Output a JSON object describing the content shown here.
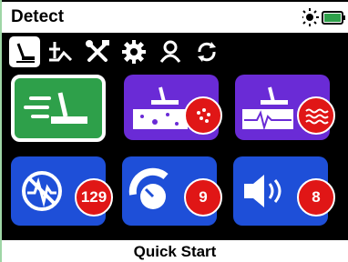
{
  "header": {
    "title": "Detect"
  },
  "status": {
    "icons": [
      "brightness-icon",
      "battery-icon"
    ],
    "battery_color": "#2ea04a"
  },
  "tabs": [
    {
      "icon": "detect-icon",
      "selected": true
    },
    {
      "icon": "ground-balance-icon"
    },
    {
      "icon": "tools-icon"
    },
    {
      "icon": "settings-icon"
    },
    {
      "icon": "user-icon"
    },
    {
      "icon": "sync-icon"
    }
  ],
  "tiles": [
    {
      "name": "quick-start",
      "icon": "coil-sweep-icon"
    },
    {
      "name": "ground-type",
      "icon": "ground-mineralization-icon"
    },
    {
      "name": "soil-noise",
      "icon": "noise-wave-icon"
    },
    {
      "name": "noise-cancel",
      "value": "129",
      "icon": "noise-cancel-icon"
    },
    {
      "name": "sensitivity",
      "value": "9",
      "icon": "sensitivity-dial-icon"
    },
    {
      "name": "volume",
      "value": "8",
      "icon": "speaker-icon"
    }
  ],
  "footer": {
    "label": "Quick Start"
  }
}
